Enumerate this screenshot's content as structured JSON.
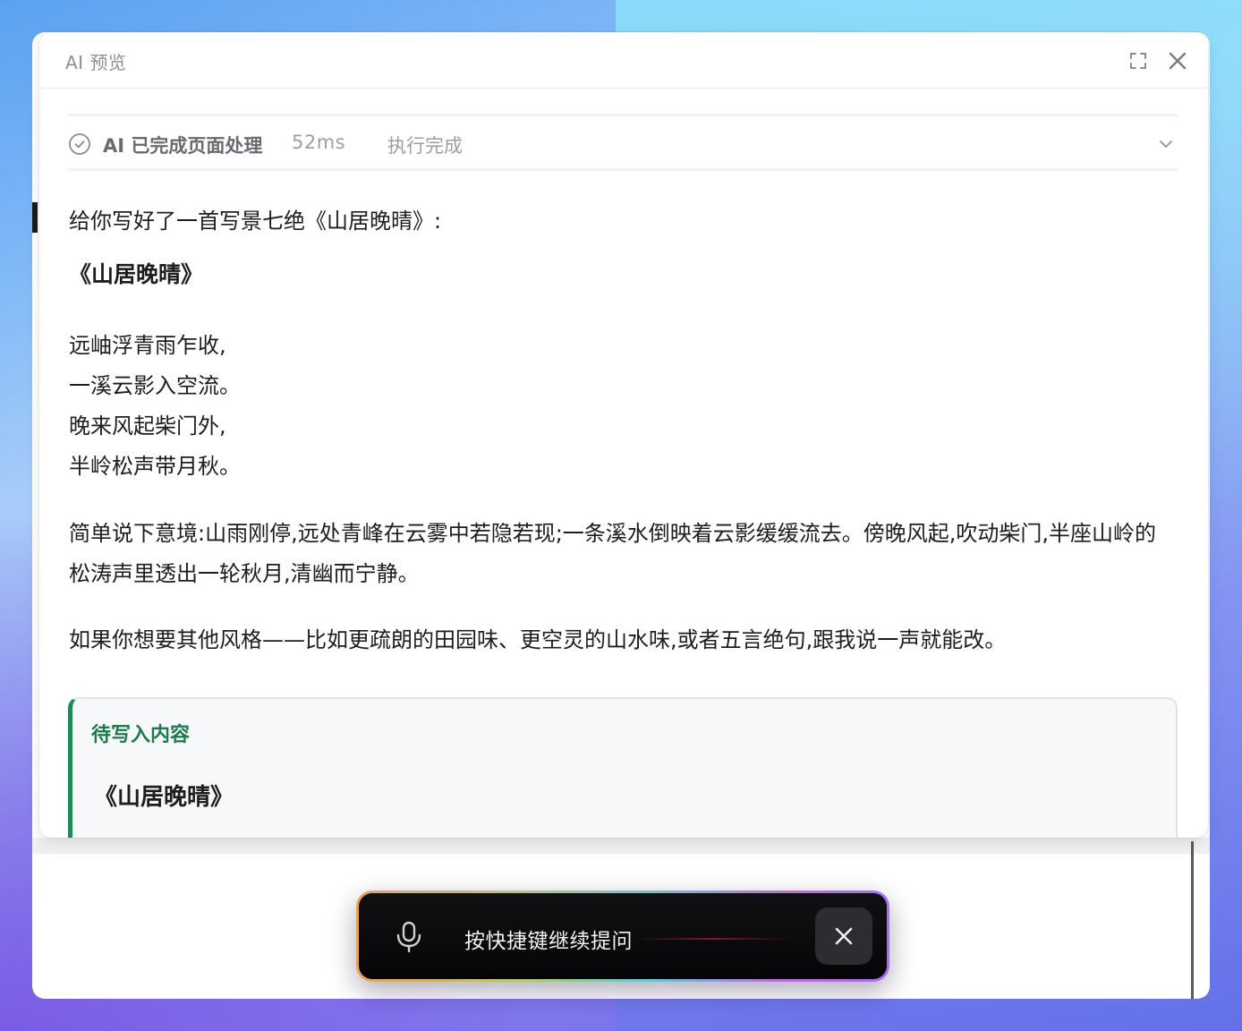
{
  "preview": {
    "title": "AI 预览",
    "expand_icon": "fullscreen-icon",
    "close_icon": "close-icon"
  },
  "status": {
    "title": "AI 已完成页面处理",
    "duration": "52ms",
    "state": "执行完成",
    "icon": "check-circle-icon"
  },
  "content": {
    "intro": "给你写好了一首写景七绝《山居晚晴》:",
    "poem_title": "《山居晚晴》",
    "poem_lines": [
      "远岫浮青雨乍收,",
      "一溪云影入空流。",
      "晚来风起柴门外,",
      "半岭松声带月秋。"
    ],
    "explanation": "简单说下意境:山雨刚停,远处青峰在云雾中若隐若现;一条溪水倒映着云影缓缓流去。傍晚风起,吹动柴门,半座山岭的松涛声里透出一轮秋月,清幽而宁静。",
    "followup": "如果你想要其他风格——比如更疏朗的田园味、更空灵的山水味,或者五言绝句,跟我说一声就能改。"
  },
  "pending": {
    "label": "待写入内容",
    "title": "《山居晚晴》"
  },
  "voice": {
    "prompt": "按快捷键继续提问",
    "mic_icon": "microphone-icon",
    "close_icon": "close-icon"
  },
  "colors": {
    "accent_green": "#1e8a5a",
    "pending_bg": "#f7f8fa",
    "voice_bg": "#0b0b0d"
  }
}
